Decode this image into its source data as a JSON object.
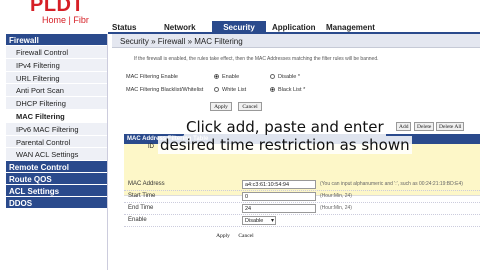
{
  "brand": {
    "logo": "PLDT",
    "sub": "Home | Fibr"
  },
  "topnav": {
    "tabs": [
      "Status",
      "Network",
      "Security",
      "Application",
      "Management"
    ],
    "active": "Security"
  },
  "sidebar": {
    "firewall_head": "Firewall",
    "items": [
      "Firewall Control",
      "IPv4 Filtering",
      "URL Filtering",
      "Anti Port Scan",
      "DHCP Filtering",
      "MAC Filtering",
      "IPv6 MAC Filtering",
      "Parental Control",
      "WAN ACL Settings"
    ],
    "active": "MAC Filtering",
    "sections": [
      "Remote Control",
      "Route QOS",
      "ACL Settings",
      "DDOS"
    ]
  },
  "main": {
    "breadcrumb": "Security » Firewall » MAC Filtering",
    "note": "If the firewall is enabled, the rules take effect, then the MAC Addresses matching the filter rules will be banned.",
    "filter_enable": {
      "label": "MAC Filtering Enable",
      "enable": "Enable",
      "disable": "Disable",
      "star": "*"
    },
    "filter_mode": {
      "label": "MAC Filtering Blacklist/Whitelist",
      "white": "White List",
      "black": "Black List",
      "star": "*"
    },
    "apply": "Apply",
    "cancel": "Cancel",
    "table": {
      "title": "MAC Address Filtering Table",
      "id_col": "ID",
      "add": "Add",
      "delete": "Delete",
      "delete_all": "Delete All"
    },
    "form": {
      "mac": {
        "label": "MAC Address",
        "value": "a4:c3:61:10:54:94",
        "hint": "(You can input alphanumeric and ':', such as 00:24:21:19:BD:E4)"
      },
      "start": {
        "label": "Start Time",
        "value": "0",
        "hint": "(Hour:Min, 24)"
      },
      "end": {
        "label": "End Time",
        "value": "24",
        "hint": "(Hour:Min, 24)"
      },
      "enable": {
        "label": "Enable",
        "value": "Disable"
      },
      "apply": "Apply",
      "cancel": "Cancel"
    }
  },
  "overlay": {
    "line1": "Click add, paste and enter",
    "line2": "desired time restriction as shown"
  }
}
